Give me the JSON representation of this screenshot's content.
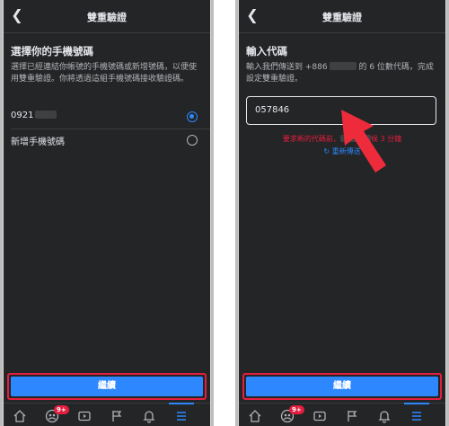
{
  "common": {
    "page_title": "雙重驗證",
    "continue_label": "繼續",
    "tabs": [
      {
        "icon": "home-icon"
      },
      {
        "icon": "groups-icon",
        "badge": "9+"
      },
      {
        "icon": "video-icon"
      },
      {
        "icon": "flag-icon"
      },
      {
        "icon": "bell-icon"
      },
      {
        "icon": "menu-icon"
      }
    ]
  },
  "left": {
    "heading": "選擇你的手機號碼",
    "description": "選擇已經連結你帳號的手機號碼或新增號碼，以便使用雙重驗證。你將透過這組手機號碼接收驗證碼。",
    "options": [
      {
        "label": "0921",
        "selected": true
      },
      {
        "label": "新增手機號碼",
        "selected": false
      }
    ]
  },
  "right": {
    "heading": "輸入代碼",
    "description_a": "輸入我們傳送到 +886",
    "description_b": "的 6 位數代碼，完成設定雙重驗證。",
    "code_value": "057846",
    "resend_note_a": "要求新的代碼前，",
    "resend_note_b": "候 3 分鐘",
    "resend_link": "重新傳送"
  },
  "colors": {
    "background": "#242526",
    "accent": "#2d88ff",
    "highlight": "#e41e3f",
    "arrow": "#ee2b3b"
  }
}
